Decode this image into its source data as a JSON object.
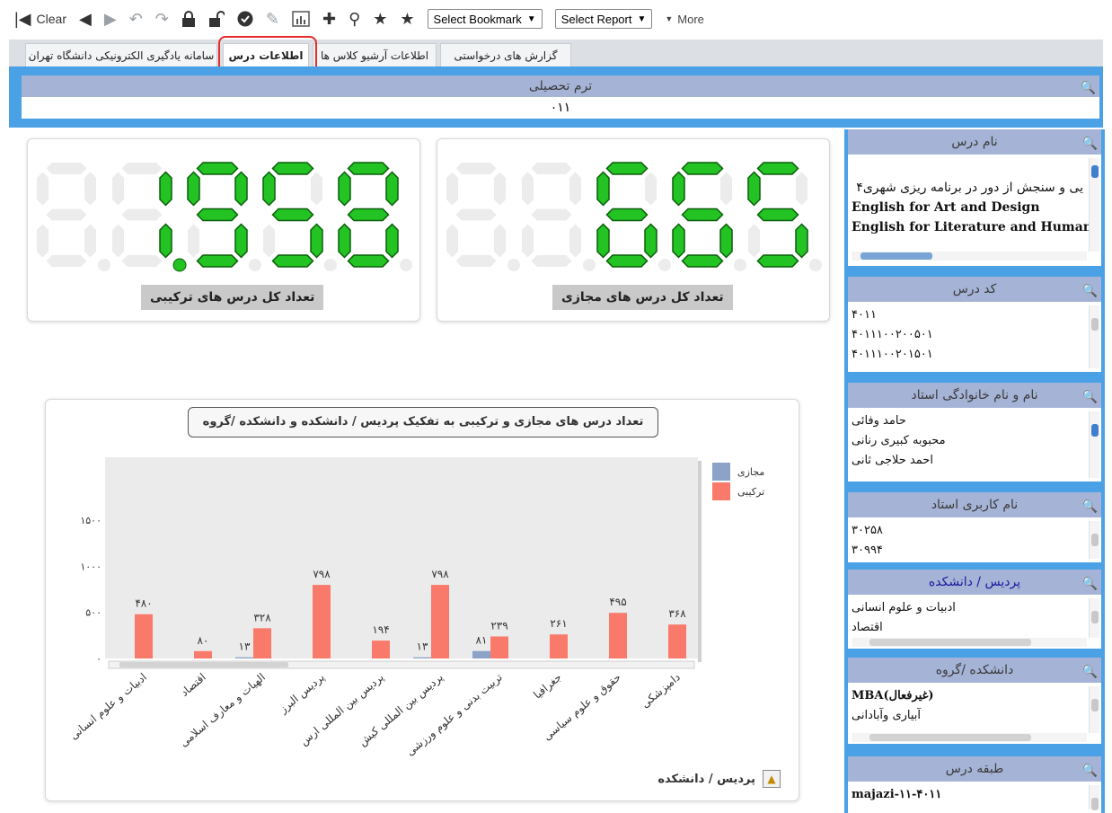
{
  "toolbar": {
    "clear_label": "Clear",
    "bookmark_label": "Select Bookmark",
    "report_label": "Select Report",
    "more_label": "More"
  },
  "tabs": [
    {
      "label": "سامانه یادگیری الکترونیکی دانشگاه تهران"
    },
    {
      "label": "اطلاعات درس"
    },
    {
      "label": "اطلاعات آرشیو کلاس ها"
    },
    {
      "label": "گزارش های درخواستی"
    }
  ],
  "term": {
    "header": "ترم تحصیلی",
    "value": "۰۱۱"
  },
  "kpis": {
    "combined": {
      "label": "تعداد کل درس های ترکیبی",
      "value": "1,958"
    },
    "virtual": {
      "label": "تعداد کل درس های مجازی",
      "value": "665"
    }
  },
  "chart_card": {
    "footer_label": "پردیس / دانشکده"
  },
  "chart_data": {
    "type": "bar",
    "title": "تعداد درس های مجازی و ترکیبی به تفکیک پردیس / دانشکده و دانشکده /گروه",
    "xlabel": "پردیس / دانشکده",
    "ylabel": "",
    "yticks": [
      "۰",
      "۵۰۰",
      "۱۰۰۰",
      "۱۵۰۰"
    ],
    "ylim": [
      0,
      1500
    ],
    "legend_position": "top-right",
    "categories": [
      "ادبیات و علوم انسانی",
      "اقتصاد",
      "الهیات و معارف اسلامی",
      "پردیس البرز",
      "پردیس بین المللی ارس",
      "پردیس بین المللی کیش",
      "تربیت بدنی و علوم ورزشی",
      "جغرافیا",
      "حقوق و علوم سیاسی",
      "دامپزشکی"
    ],
    "series": [
      {
        "name": "مجازی",
        "color": "#8ca2c8",
        "values": [
          0,
          0,
          13,
          0,
          0,
          13,
          81,
          0,
          0,
          0
        ],
        "labels": [
          "",
          "",
          "۱۳",
          "",
          "",
          "۱۳",
          "۸۱",
          "",
          "",
          ""
        ]
      },
      {
        "name": "ترکیبی",
        "color": "#f97a6a",
        "values": [
          480,
          80,
          328,
          798,
          194,
          798,
          239,
          261,
          495,
          368
        ],
        "labels": [
          "۴۸۰",
          "۸۰",
          "۳۲۸",
          "۷۹۸",
          "۱۹۴",
          "۷۹۸",
          "۲۳۹",
          "۲۶۱",
          "۴۹۵",
          "۳۶۸"
        ]
      }
    ]
  },
  "filters": [
    {
      "title": "نام درس",
      "items": [
        "یی و سنجش از دور در برنامه ریزی شهری۴",
        "English for Art and Design",
        "English for Literature and Human"
      ]
    },
    {
      "title": "کد درس",
      "items": [
        "۴۰۱۱",
        "۴۰۱۱۱۰۰۲۰۰۵۰۱",
        "۴۰۱۱۱۰۰۲۰۱۵۰۱"
      ]
    },
    {
      "title": "نام و نام خانوادگی استاد",
      "items": [
        "حامد وفائی",
        "محبوبه کبیری رنانی",
        "احمد حلاجی ثانی"
      ]
    },
    {
      "title": "نام کاربری استاد",
      "items": [
        "۳۰۲۵۸",
        "۳۰۹۹۴"
      ]
    },
    {
      "title": "پردیس / دانشکده",
      "items": [
        "ادبیات و علوم انسانی",
        "اقتصاد"
      ]
    },
    {
      "title": "دانشکده /گروه",
      "items": [
        "MBA(غیرفعال)",
        "آبیاری وآبادانی"
      ]
    },
    {
      "title": "طبقه درس",
      "items": [
        "majazi-۱۱-۴۰۱۱"
      ]
    }
  ]
}
